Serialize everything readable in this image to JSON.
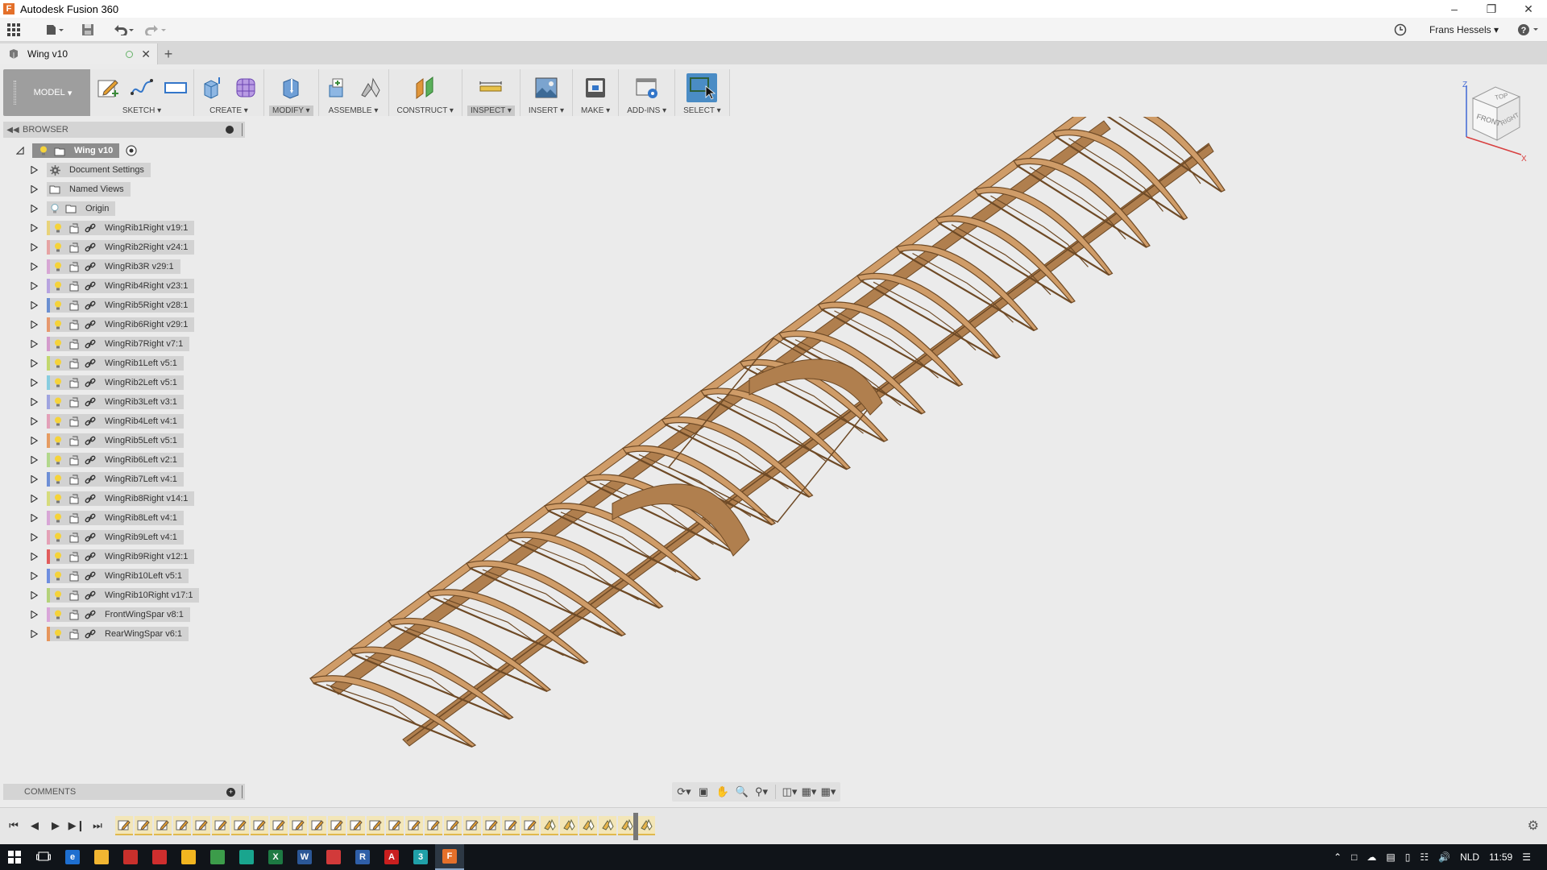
{
  "app": {
    "title": "Autodesk Fusion 360",
    "logo_letter": "F"
  },
  "window_controls": [
    "minimize-icon",
    "restore-icon",
    "close-icon"
  ],
  "quick_access": {
    "user_name": "Frans Hessels",
    "help_label": "?"
  },
  "document_tab": {
    "label": "Wing v10"
  },
  "ribbon": {
    "workspace": "MODEL",
    "groups": [
      {
        "label": "SKETCH",
        "icons": [
          "create-sketch-icon",
          "spline-icon",
          "rectangle-icon"
        ]
      },
      {
        "label": "CREATE",
        "icons": [
          "extrude-icon",
          "form-icon"
        ]
      },
      {
        "label": "MODIFY",
        "icons": [
          "press-pull-icon"
        ]
      },
      {
        "label": "ASSEMBLE",
        "icons": [
          "new-component-icon",
          "joint-icon"
        ]
      },
      {
        "label": "CONSTRUCT",
        "icons": [
          "offset-plane-icon"
        ]
      },
      {
        "label": "INSPECT",
        "icons": [
          "measure-icon"
        ]
      },
      {
        "label": "INSERT",
        "icons": [
          "insert-image-icon"
        ]
      },
      {
        "label": "MAKE",
        "icons": [
          "3d-print-icon"
        ]
      },
      {
        "label": "ADD-INS",
        "icons": [
          "scripts-icon"
        ]
      },
      {
        "label": "SELECT",
        "icons": [
          "select-icon"
        ]
      }
    ]
  },
  "browser": {
    "header": "BROWSER",
    "root": "Wing v10",
    "system_items": [
      "Document Settings",
      "Named Views",
      "Origin"
    ],
    "components": [
      {
        "label": "WingRib1Right v19:1",
        "color": "#e8d37a"
      },
      {
        "label": "WingRib2Right v24:1",
        "color": "#e6a3a3"
      },
      {
        "label": "WingRib3R v29:1",
        "color": "#d7a6d4"
      },
      {
        "label": "WingRib4Right v23:1",
        "color": "#b7a3e0"
      },
      {
        "label": "WingRib5Right v28:1",
        "color": "#6b8fd1"
      },
      {
        "label": "WingRib6Right v29:1",
        "color": "#e6986e"
      },
      {
        "label": "WingRib7Right v7:1",
        "color": "#d49bcc"
      },
      {
        "label": "WingRib1Left v5:1",
        "color": "#c2d86e"
      },
      {
        "label": "WingRib2Left v5:1",
        "color": "#88cde0"
      },
      {
        "label": "WingRib3Left v3:1",
        "color": "#9fa3e0"
      },
      {
        "label": "WingRib4Left v4:1",
        "color": "#e3a0b8"
      },
      {
        "label": "WingRib5Left v5:1",
        "color": "#e69c62"
      },
      {
        "label": "WingRib6Left v2:1",
        "color": "#b2d88c"
      },
      {
        "label": "WingRib7Left v4:1",
        "color": "#6e8fd6"
      },
      {
        "label": "WingRib8Right v14:1",
        "color": "#d6dc7c"
      },
      {
        "label": "WingRib8Left v4:1",
        "color": "#d8a6d6"
      },
      {
        "label": "WingRib9Left v4:1",
        "color": "#e4a1b6"
      },
      {
        "label": "WingRib9Right v12:1",
        "color": "#e15c5c"
      },
      {
        "label": "WingRib10Left v5:1",
        "color": "#6f8ee0"
      },
      {
        "label": "WingRib10Right v17:1",
        "color": "#b4d27a"
      },
      {
        "label": "FrontWingSpar v8:1",
        "color": "#d9a5d9"
      },
      {
        "label": "RearWingSpar v6:1",
        "color": "#e6955c"
      }
    ]
  },
  "comments": {
    "header": "COMMENTS"
  },
  "viewcube": {
    "top": "TOP",
    "front": "FRONT",
    "right": "RIGHT",
    "axis_x": "X",
    "axis_z": "Z"
  },
  "navbar": [
    "orbit-icon",
    "look-at-icon",
    "pan-icon",
    "zoom-icon",
    "zoom-window-icon",
    "display-settings-icon",
    "grid-icon",
    "viewports-icon"
  ],
  "timeline": {
    "sketch_steps": 22,
    "joint_steps": 6
  },
  "taskbar": {
    "apps": [
      {
        "name": "start-icon"
      },
      {
        "name": "task-view-icon"
      },
      {
        "name": "edge-icon",
        "color": "#1e6fd0",
        "glyph": "e"
      },
      {
        "name": "explorer-icon",
        "color": "#f2b632",
        "glyph": ""
      },
      {
        "name": "app-red-icon",
        "color": "#c9302c",
        "glyph": ""
      },
      {
        "name": "app-circle-icon",
        "color": "#cf2e2e",
        "glyph": ""
      },
      {
        "name": "app-yellow-icon",
        "color": "#f1b520",
        "glyph": ""
      },
      {
        "name": "chrome-icon",
        "color": "#3c9c4a",
        "glyph": ""
      },
      {
        "name": "app-teal-icon",
        "color": "#19a58e",
        "glyph": ""
      },
      {
        "name": "excel-icon",
        "color": "#1d7a43",
        "glyph": "X"
      },
      {
        "name": "word-icon",
        "color": "#2b5797",
        "glyph": "W"
      },
      {
        "name": "app-red2-icon",
        "color": "#d23a3a",
        "glyph": ""
      },
      {
        "name": "app-r-icon",
        "color": "#2f5fa8",
        "glyph": "R"
      },
      {
        "name": "acrobat-icon",
        "color": "#c91f1f",
        "glyph": "A"
      },
      {
        "name": "app-3-icon",
        "color": "#20a0a8",
        "glyph": "3"
      },
      {
        "name": "fusion-icon",
        "color": "#e4702a",
        "glyph": "F",
        "active": true
      }
    ],
    "language": "NLD",
    "time": "11:59"
  }
}
